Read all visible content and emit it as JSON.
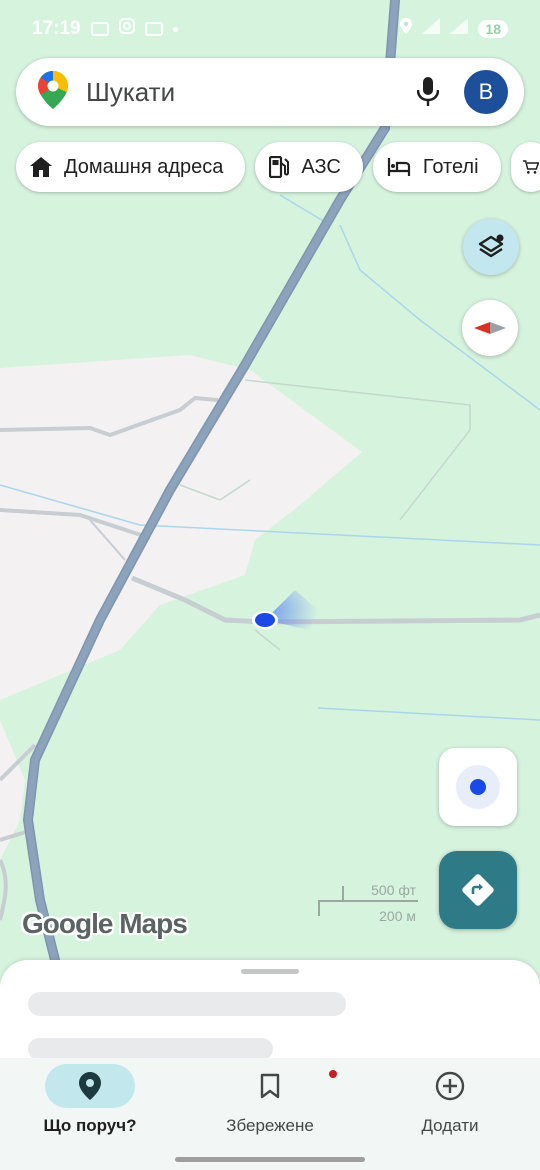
{
  "status_bar": {
    "time": "17:19",
    "battery": "18",
    "icons": [
      "notification-icon",
      "instagram-icon",
      "notification-icon",
      "location-icon",
      "signal-icon",
      "wifi-icon"
    ]
  },
  "search": {
    "placeholder": "Шукати",
    "avatar_letter": "B",
    "icons": [
      "google-maps-pin-icon",
      "microphone-icon"
    ]
  },
  "chips": [
    {
      "label": "Домашня адреса",
      "icon": "home-icon"
    },
    {
      "label": "АЗС",
      "icon": "gas-station-icon"
    },
    {
      "label": "Готелі",
      "icon": "hotel-bed-icon"
    },
    {
      "label": "",
      "icon": "shopping-cart-icon"
    }
  ],
  "map": {
    "scale_ft": "500 фт",
    "scale_m": "200 м",
    "logo": "Google Maps",
    "colors": {
      "land": "#d6f3de",
      "urban": "#f3f1f2",
      "highway": "#8da2bb",
      "road": "#c8cdd2",
      "water": "#aad6ec",
      "location_dot": "#1a49e8",
      "directions_button": "#2e7a87"
    }
  },
  "controls": {
    "icons": [
      "layers-icon",
      "compass-icon",
      "my-location-icon",
      "directions-icon"
    ]
  },
  "bottom_nav": {
    "items": [
      {
        "label": "Що поруч?",
        "icon": "explore-pin-icon",
        "active": true
      },
      {
        "label": "Збережене",
        "icon": "bookmark-icon",
        "active": false
      },
      {
        "label": "Додати",
        "icon": "add-circle-icon",
        "active": false
      }
    ]
  }
}
